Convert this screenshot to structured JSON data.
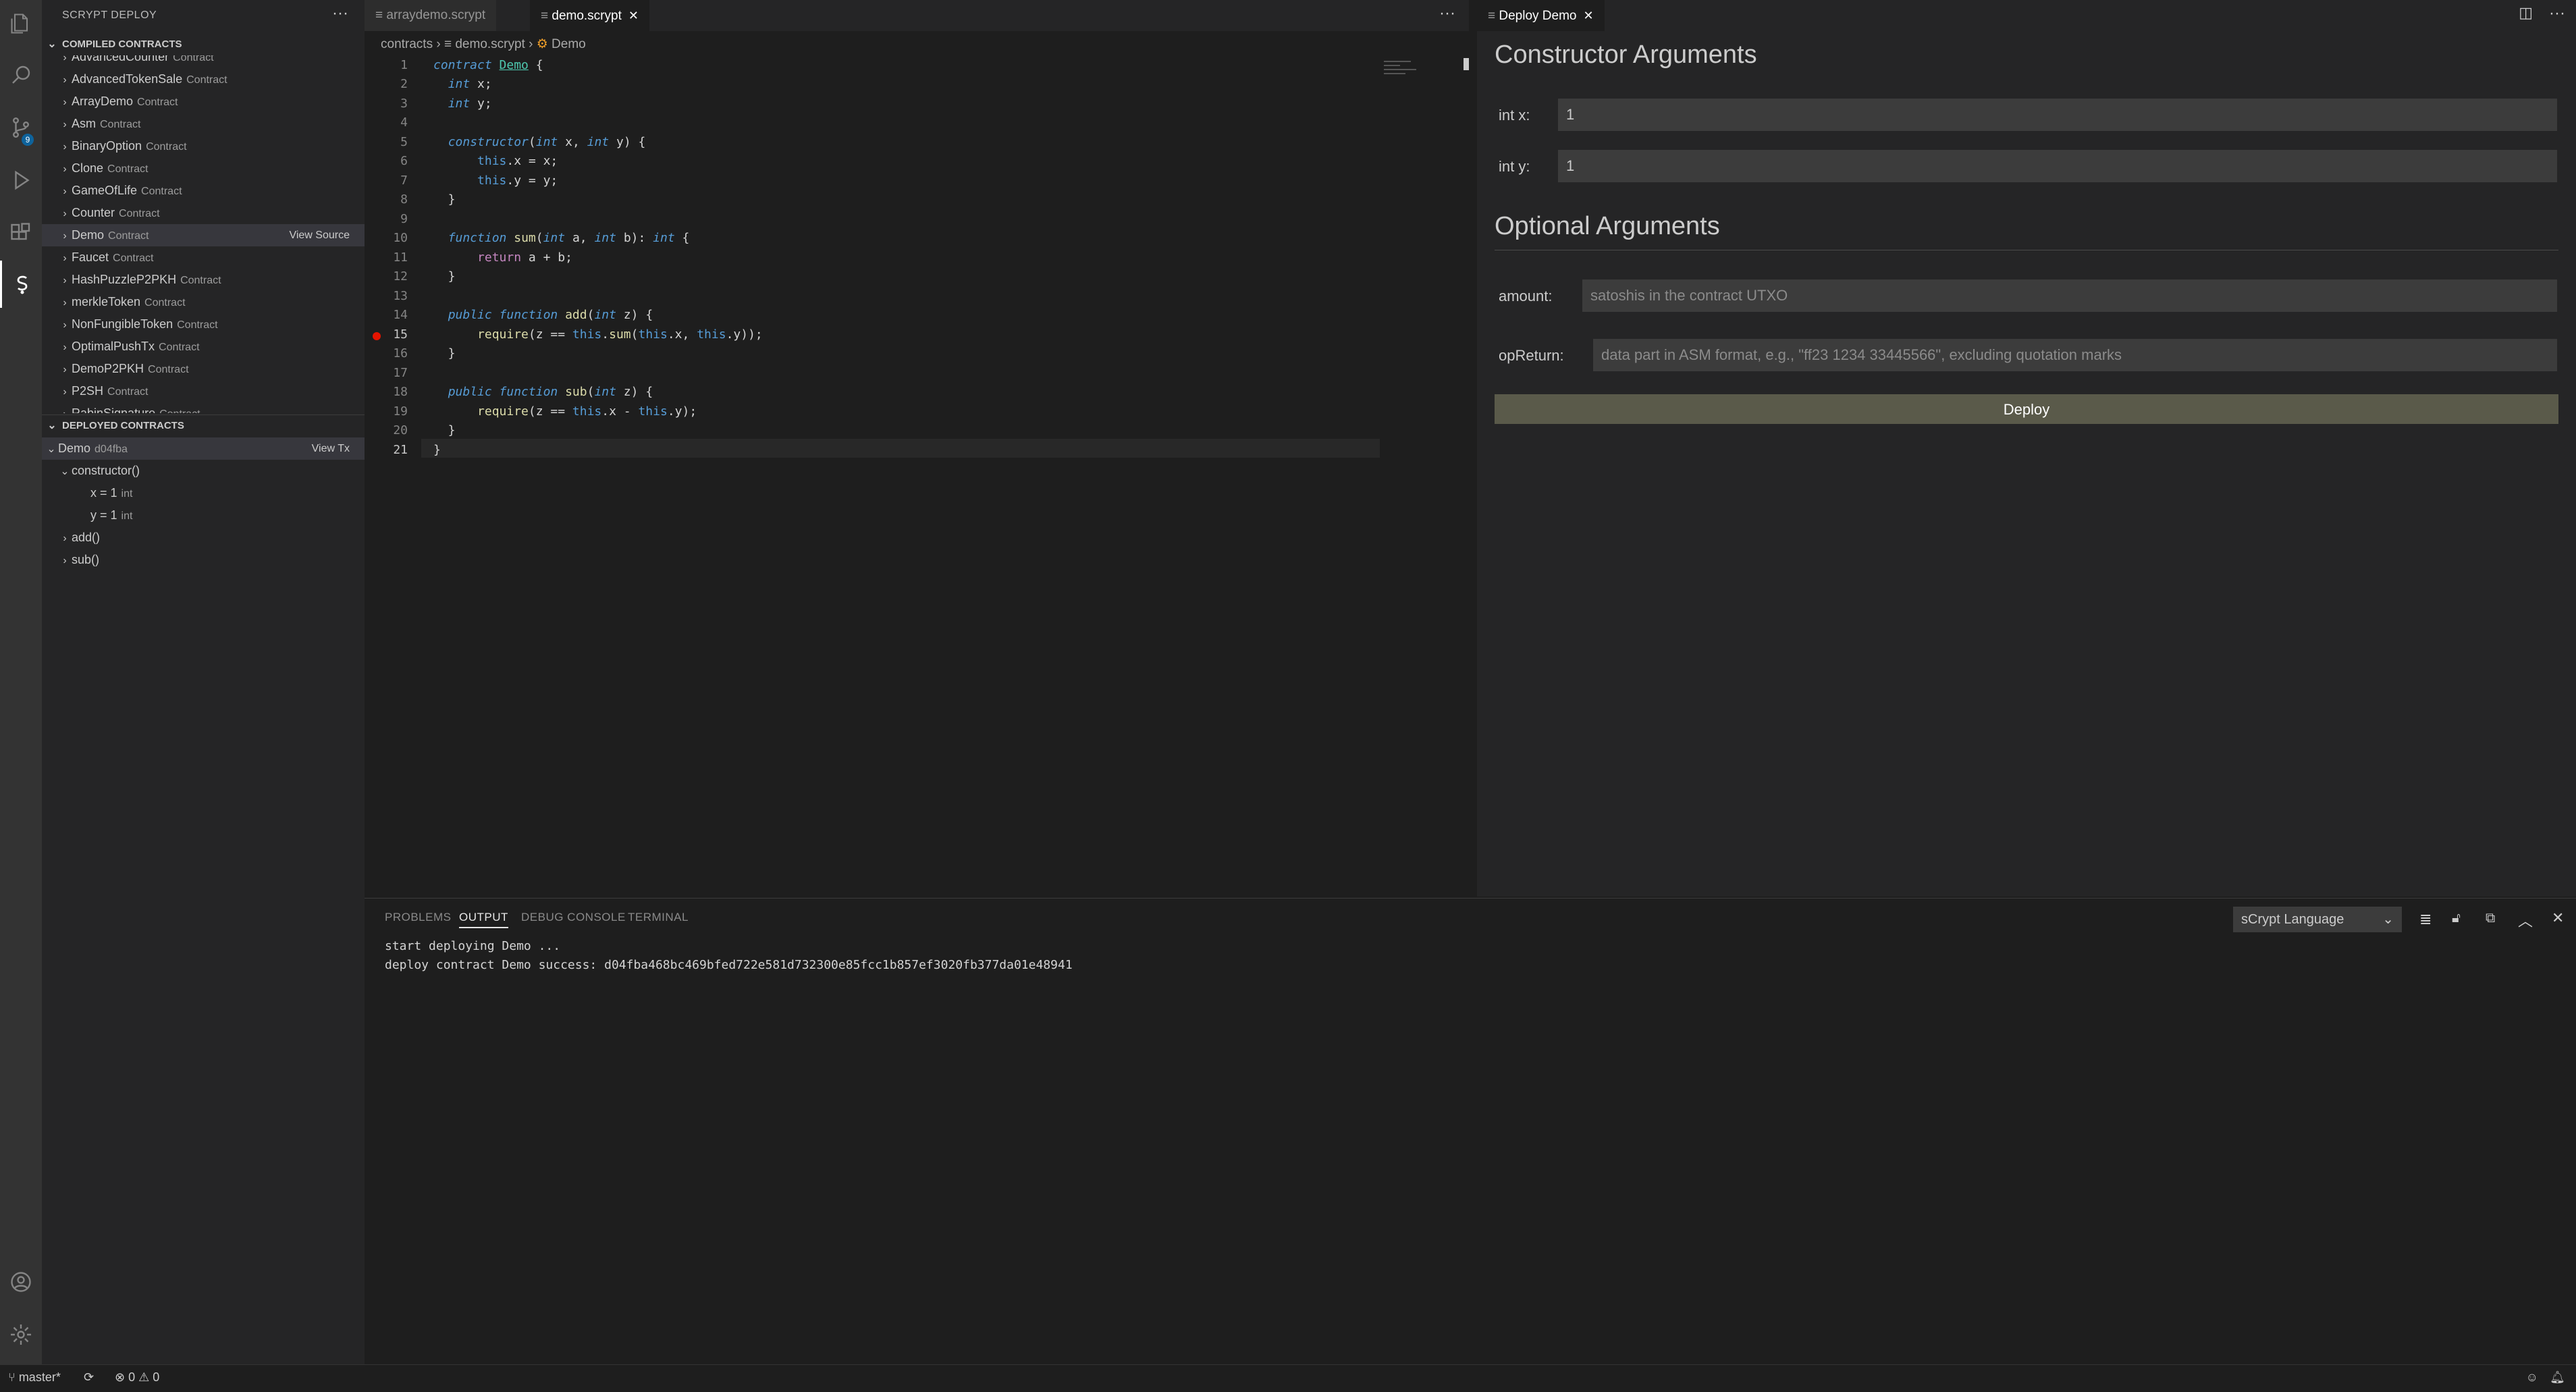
{
  "sidebar": {
    "title": "SCRYPT DEPLOY",
    "compiled_header": "COMPILED CONTRACTS",
    "compiled": [
      {
        "name": "AdvancedCounter",
        "kind": "Contract"
      },
      {
        "name": "AdvancedTokenSale",
        "kind": "Contract"
      },
      {
        "name": "ArrayDemo",
        "kind": "Contract"
      },
      {
        "name": "Asm",
        "kind": "Contract"
      },
      {
        "name": "BinaryOption",
        "kind": "Contract"
      },
      {
        "name": "Clone",
        "kind": "Contract"
      },
      {
        "name": "GameOfLife",
        "kind": "Contract"
      },
      {
        "name": "Counter",
        "kind": "Contract"
      },
      {
        "name": "Demo",
        "kind": "Contract"
      },
      {
        "name": "Faucet",
        "kind": "Contract"
      },
      {
        "name": "HashPuzzleP2PKH",
        "kind": "Contract"
      },
      {
        "name": "merkleToken",
        "kind": "Contract"
      },
      {
        "name": "NonFungibleToken",
        "kind": "Contract"
      },
      {
        "name": "OptimalPushTx",
        "kind": "Contract"
      },
      {
        "name": "DemoP2PKH",
        "kind": "Contract"
      },
      {
        "name": "P2SH",
        "kind": "Contract"
      },
      {
        "name": "RabinSignature",
        "kind": "Contract"
      }
    ],
    "view_source": "View Source",
    "deployed_header": "DEPLOYED CONTRACTS",
    "deployed": {
      "name": "Demo",
      "id": "d04fba",
      "view_tx": "View Tx",
      "constructor": "constructor()",
      "params": [
        {
          "name": "x = 1",
          "type": "int"
        },
        {
          "name": "y = 1",
          "type": "int"
        }
      ],
      "methods": [
        "add()",
        "sub()"
      ]
    }
  },
  "editor": {
    "tabs": [
      "arraydemo.scrypt",
      "demo.scrypt"
    ],
    "breadcrumb": [
      "contracts",
      "demo.scrypt",
      "Demo"
    ],
    "more": "···"
  },
  "right": {
    "tab": "Deploy Demo",
    "constructor_title": "Constructor Arguments",
    "fields": [
      {
        "label": "int x:",
        "value": "1"
      },
      {
        "label": "int y:",
        "value": "1"
      }
    ],
    "optional_title": "Optional Arguments",
    "amount_label": "amount:",
    "amount_placeholder": "satoshis in the contract UTXO",
    "opreturn_label": "opReturn:",
    "opreturn_placeholder": "data part in ASM format, e.g., \"ff23 1234 33445566\", excluding quotation marks",
    "deploy_label": "Deploy"
  },
  "panel": {
    "tabs": [
      "PROBLEMS",
      "OUTPUT",
      "DEBUG CONSOLE",
      "TERMINAL"
    ],
    "active_tab": "OUTPUT",
    "channel": "sCrypt Language",
    "lines": [
      "start deploying Demo ...",
      "deploy contract Demo success: d04fba468bc469bfed722e581d732300e85fcc1b857ef3020fb377da01e48941"
    ]
  },
  "status": {
    "branch": "master*",
    "errors": "0",
    "warnings": "0"
  }
}
